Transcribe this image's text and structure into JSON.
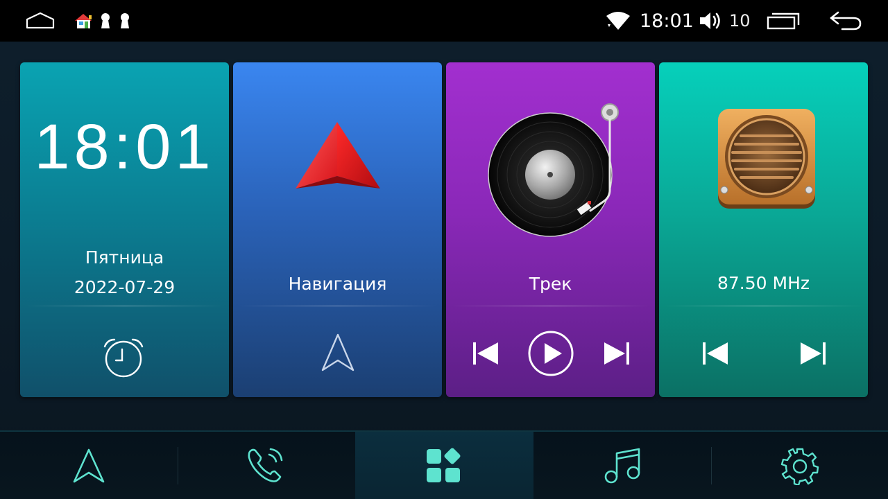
{
  "status_bar": {
    "time": "18:01",
    "volume": "10",
    "icons": [
      "home-outline-icon",
      "app-notification-icon",
      "keyhole-icon",
      "keyhole-icon",
      "wifi-icon",
      "volume-icon",
      "recent-apps-icon",
      "back-icon"
    ]
  },
  "cards": {
    "clock": {
      "time": "18:01",
      "weekday": "Пятница",
      "date": "2022-07-29",
      "icon": "alarm-clock-icon",
      "color": "#0aa3b2"
    },
    "navigation": {
      "label": "Навигация",
      "icons": [
        "red-arrow-icon",
        "navigation-arrow-icon"
      ],
      "color": "#3a86f0"
    },
    "music": {
      "label": "Трек",
      "icons": [
        "vinyl-turntable-icon",
        "previous-track-icon",
        "play-icon",
        "next-track-icon"
      ],
      "color": "#a22fcf"
    },
    "radio": {
      "frequency": "87.50  MHz",
      "icons": [
        "radio-speaker-icon",
        "previous-station-icon",
        "next-station-icon"
      ],
      "color": "#06d0bb"
    }
  },
  "dock": {
    "items": [
      "navigation",
      "phone",
      "apps",
      "music",
      "settings"
    ],
    "active": "apps",
    "accent": "#5ee3cf"
  }
}
